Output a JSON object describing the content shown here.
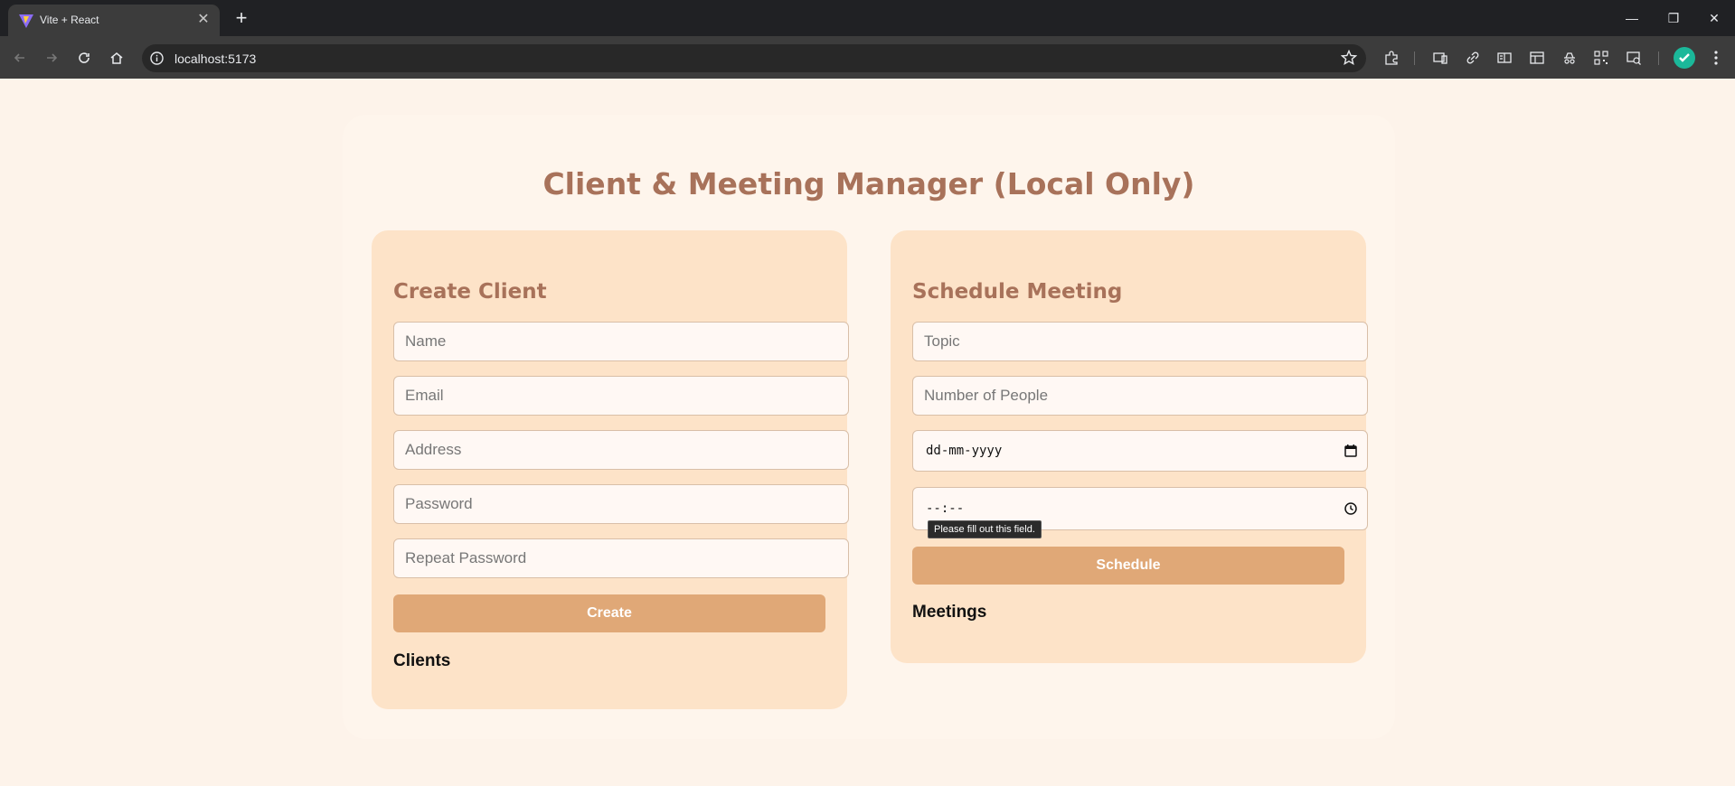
{
  "browser": {
    "tab_title": "Vite + React",
    "url": "localhost:5173"
  },
  "page": {
    "title": "Client & Meeting Manager (Local Only)"
  },
  "client_form": {
    "heading": "Create Client",
    "name_placeholder": "Name",
    "email_placeholder": "Email",
    "address_placeholder": "Address",
    "password_placeholder": "Password",
    "repeat_password_placeholder": "Repeat Password",
    "submit_label": "Create",
    "list_heading": "Clients"
  },
  "meeting_form": {
    "heading": "Schedule Meeting",
    "topic_placeholder": "Topic",
    "people_placeholder": "Number of People",
    "date_format": "dd-mm-yyyy",
    "time_format": "--:--",
    "validation_tooltip": "Please fill out this field.",
    "submit_label": "Schedule",
    "list_heading": "Meetings"
  },
  "colors": {
    "accent": "#a8725a",
    "button": "#e0a877",
    "panel": "#fde3c8",
    "card": "#fef5ec",
    "page_background": "#fdf3ea"
  },
  "icons": [
    "vite-logo-icon",
    "close-icon",
    "plus-icon",
    "minimize-icon",
    "restore-icon",
    "back-icon",
    "forward-icon",
    "reload-icon",
    "home-icon",
    "site-info-icon",
    "star-icon",
    "extensions-icon",
    "calendar-icon",
    "clock-icon"
  ]
}
